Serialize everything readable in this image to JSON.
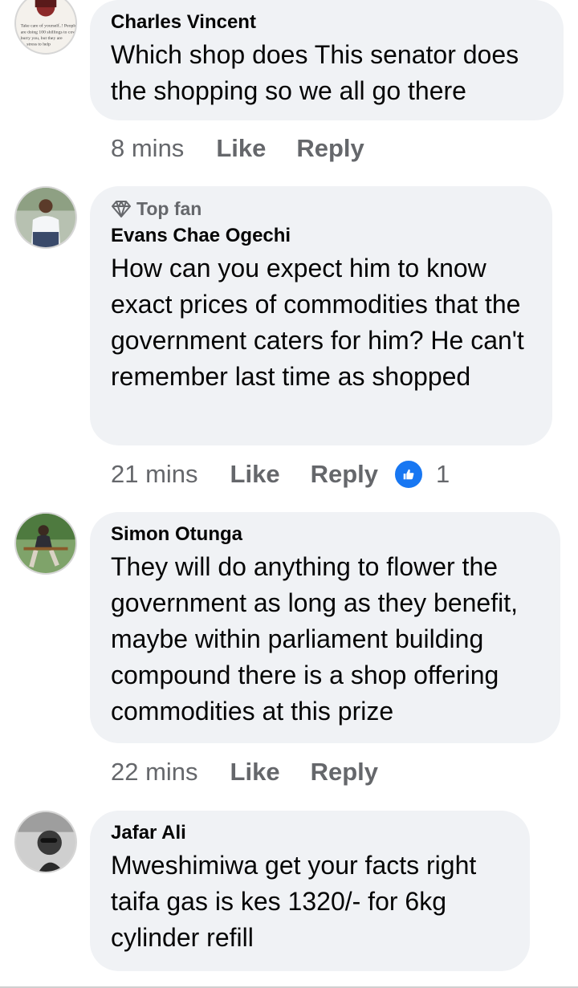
{
  "comments": [
    {
      "author": "Charles Vincent",
      "text": "Which shop does This senator does the shopping so we all go there",
      "time": "8 mins",
      "like": "Like",
      "reply": "Reply",
      "avatar_text": "Take care of yourself...! People are doing 100 shillings to cover burry you, but they are stress to help"
    },
    {
      "badge": "Top fan",
      "author": "Evans Chae Ogechi",
      "text": "How can you expect him to know exact prices of commodities that the government caters for him? He can't remember last time as shopped",
      "time": "21 mins",
      "like": "Like",
      "reply": "Reply",
      "reactions": "1"
    },
    {
      "author": "Simon Otunga",
      "text": "They will do anything to flower the government as long as they benefit, maybe within parliament building compound there is a shop offering commodities at this prize",
      "time": "22 mins",
      "like": "Like",
      "reply": "Reply"
    },
    {
      "author": "Jafar Ali",
      "text": "Mweshimiwa get your facts right taifa gas is kes 1320/- for 6kg cylinder refill"
    }
  ],
  "colors": {
    "bubble": "#f0f2f5",
    "meta": "#65676b",
    "like_blue": "#1877f2"
  }
}
